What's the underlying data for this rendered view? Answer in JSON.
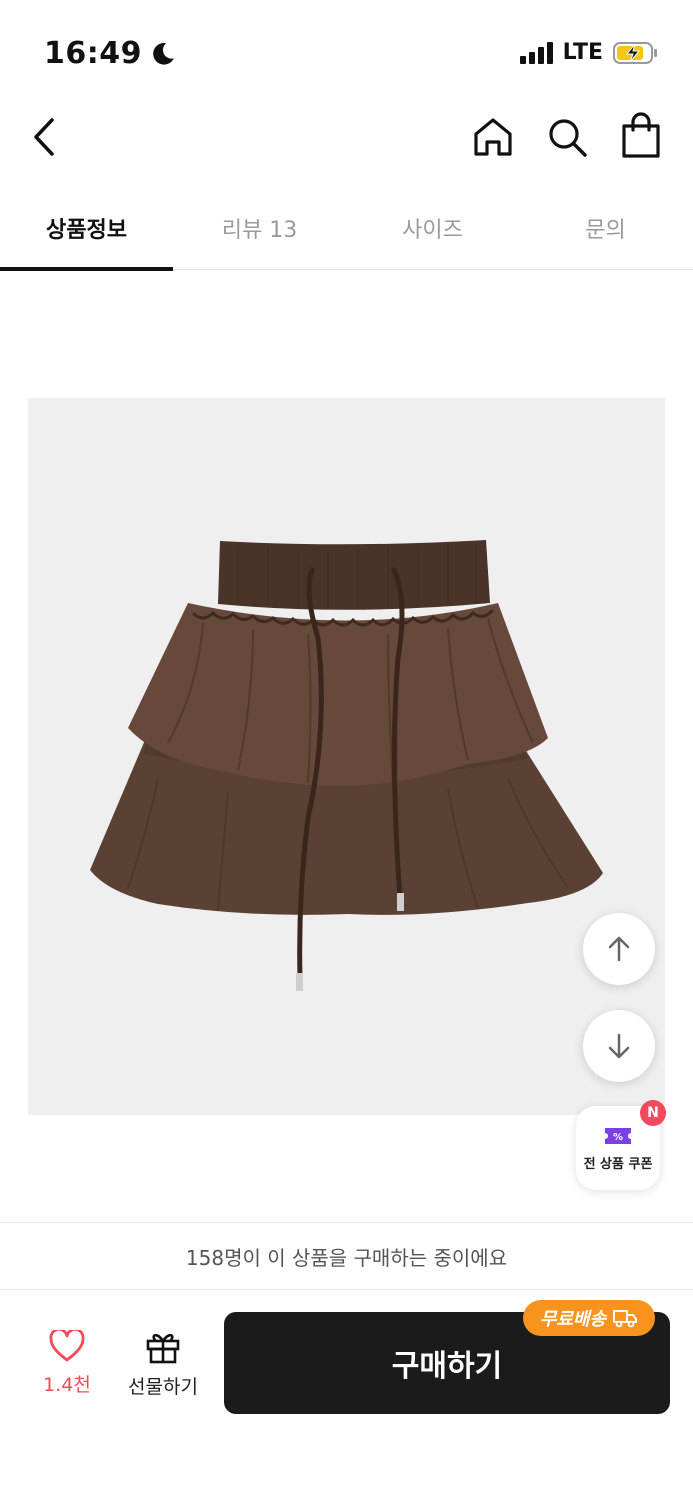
{
  "status_bar": {
    "time": "16:49",
    "network": "LTE",
    "icons": [
      "moon-icon",
      "signal-icon",
      "battery-charging-icon"
    ]
  },
  "header": {
    "icons": [
      "back-icon",
      "home-icon",
      "search-icon",
      "shopping-bag-icon"
    ]
  },
  "tabs": [
    {
      "label": "상품정보",
      "active": true
    },
    {
      "label": "리뷰 13",
      "active": false
    },
    {
      "label": "사이즈",
      "active": false
    },
    {
      "label": "문의",
      "active": false
    }
  ],
  "product": {
    "image_icon": "brown-tiered-mini-skirt-image"
  },
  "floating": {
    "scroll_up_icon": "arrow-up-icon",
    "scroll_down_icon": "arrow-down-icon",
    "coupon_label": "전 상품 쿠폰",
    "coupon_badge": "N"
  },
  "notice": {
    "text": "158명이 이 상품을 구매하는 중이에요"
  },
  "bottom_bar": {
    "like_count": "1.4천",
    "gift_label": "선물하기",
    "buy_label": "구매하기",
    "shipping_badge": "무료배송"
  },
  "colors": {
    "accent_like": "#ef4b57",
    "buy_button": "#1b1b1b",
    "shipping_badge": "#f7931e",
    "coupon_icon": "#7b3fe4"
  }
}
